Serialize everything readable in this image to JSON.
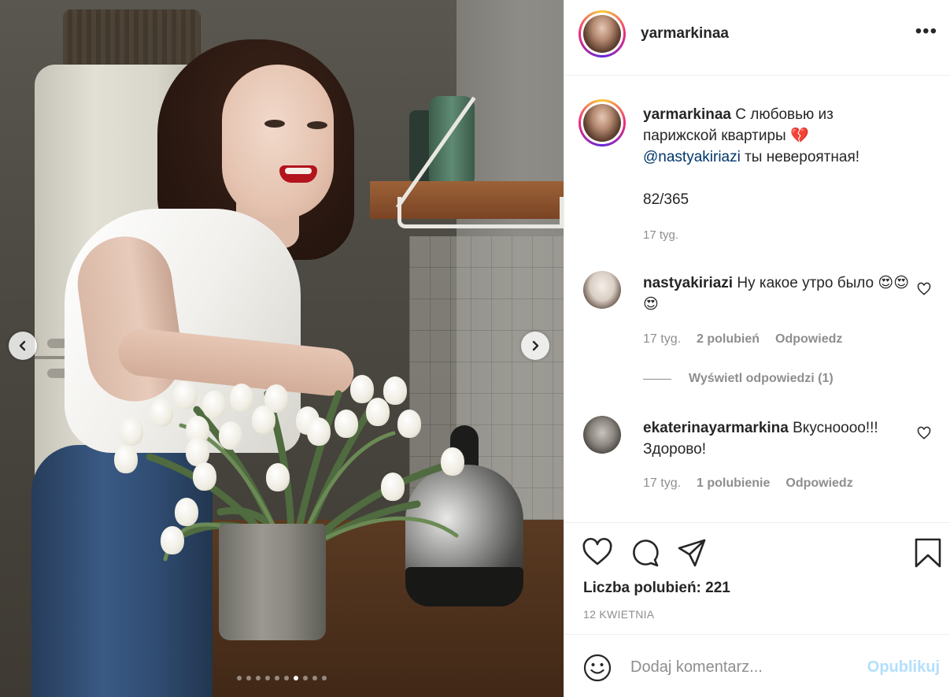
{
  "post": {
    "username": "yarmarkinaa",
    "more_icon": "more-horizontal-icon",
    "carousel": {
      "total_slides": 10,
      "active_slide": 7
    }
  },
  "caption": {
    "username": "yarmarkinaa",
    "text_part1": "С любовью из парижской квартиры 💔",
    "mention": "@nastyakiriazi",
    "text_part2": "ты невероятная!",
    "counter": "82/365",
    "time": "17 tyg."
  },
  "comments": [
    {
      "username": "nastyakiriazi",
      "text": "Ну какое утро было 😍😍😍",
      "time": "17 tyg.",
      "likes": "2 polubień",
      "reply": "Odpowiedz",
      "view_replies": "Wyświetl odpowiedzi (1)"
    },
    {
      "username": "ekaterinayarmarkina",
      "text": "Вкуснoooo!!! Здорово!",
      "time": "17 tyg.",
      "likes": "1 polubienie",
      "reply": "Odpowiedz"
    }
  ],
  "actions": {
    "likes_label": "Liczba polubień: 221",
    "date": "12 KWIETNIA",
    "icons": [
      "heart-icon",
      "comment-icon",
      "share-icon",
      "bookmark-icon"
    ]
  },
  "comment_box": {
    "placeholder": "Dodaj komentarz...",
    "publish_label": "Opublikuj",
    "emoji_icon": "smiley-icon"
  },
  "colors": {
    "link": "#00376b",
    "muted": "#8e8e8e",
    "publish_disabled": "#b2dffc",
    "text": "#262626"
  }
}
